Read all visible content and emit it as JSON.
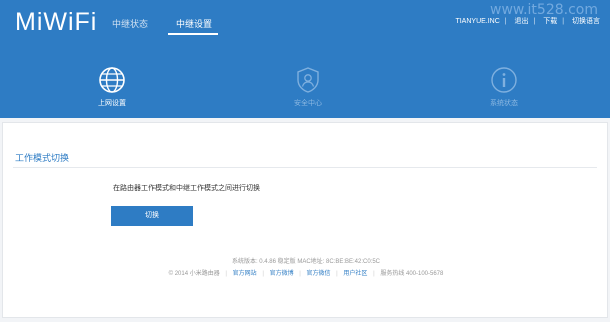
{
  "header": {
    "logo": "MiWiFi",
    "tabs": [
      {
        "label": "中继状态",
        "active": false
      },
      {
        "label": "中继设置",
        "active": true
      }
    ],
    "user": {
      "name": "TIANYUE.INC",
      "links": [
        "退出",
        "下载",
        "切换语言"
      ]
    },
    "watermark": "www.it528.com"
  },
  "nav": [
    {
      "label": "上网设置",
      "icon": "globe-icon",
      "active": true
    },
    {
      "label": "安全中心",
      "icon": "shield-user-icon",
      "active": false
    },
    {
      "label": "系统状态",
      "icon": "info-icon",
      "active": false
    }
  ],
  "main": {
    "section_title": "工作模式切换",
    "description": "在路由器工作模式和中继工作模式之间进行切换",
    "switch_button": "切换"
  },
  "footer": {
    "system_info": "系统版本: 0.4.86 稳定版   MAC地址: 8C:BE:BE:42:C0:5C",
    "copyright": "© 2014 小米路由器",
    "links": [
      "官方网站",
      "官方微博",
      "官方微信",
      "用户社区"
    ],
    "hotline": "服务热线 400-100-5678"
  },
  "colors": {
    "brand": "#2e7cc4",
    "background": "#f2f4f7"
  }
}
